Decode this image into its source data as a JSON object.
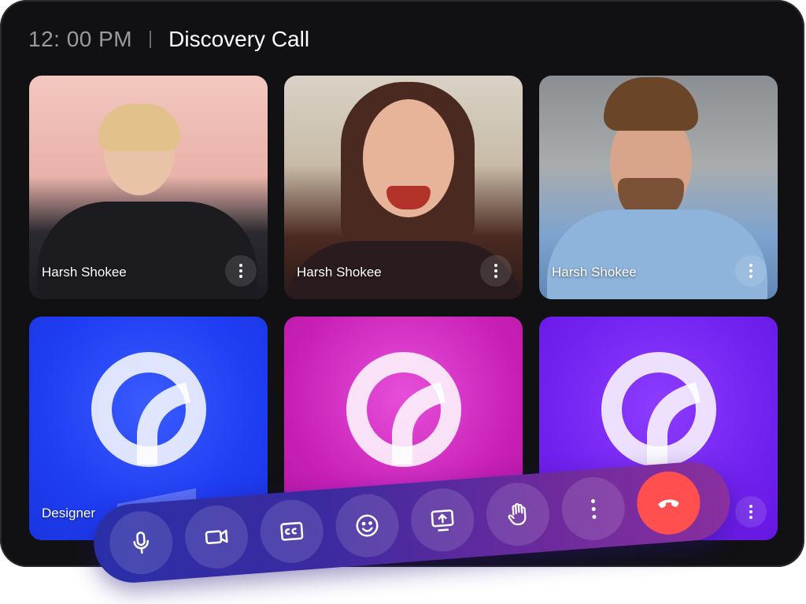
{
  "header": {
    "time": "12: 00 PM",
    "title": "Discovery Call"
  },
  "participants": [
    {
      "name": "Harsh Shokee"
    },
    {
      "name": "Harsh Shokee"
    },
    {
      "name": "Harsh Shokee"
    },
    {
      "name": "Designer"
    },
    {
      "name": ""
    },
    {
      "name": ""
    }
  ],
  "colors": {
    "tile_blue": "#1f3df2",
    "tile_pink": "#c81fb7",
    "tile_violet": "#7222f0",
    "end_call": "#ff4f4f"
  },
  "toolbar": {
    "buttons": [
      {
        "icon": "microphone-icon"
      },
      {
        "icon": "video-camera-icon"
      },
      {
        "icon": "closed-captions-icon"
      },
      {
        "icon": "emoji-icon"
      },
      {
        "icon": "share-screen-icon"
      },
      {
        "icon": "raise-hand-icon"
      },
      {
        "icon": "more-vertical-icon"
      },
      {
        "icon": "end-call-icon"
      }
    ]
  }
}
